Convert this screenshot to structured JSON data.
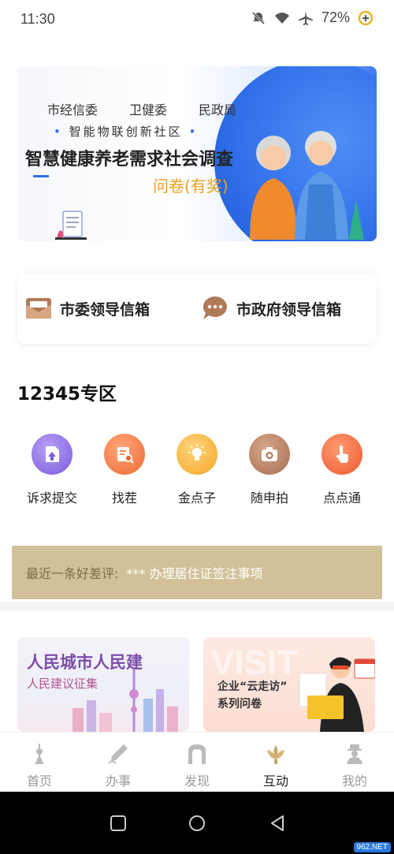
{
  "status_bar": {
    "time": "11:30",
    "battery": "72%"
  },
  "banner": {
    "agencies": [
      "市经信委",
      "卫健委",
      "民政局"
    ],
    "subtitle": "智能物联创新社区",
    "title": "智慧健康养老需求社会调查",
    "tag": "问卷(有奖)"
  },
  "mailbox": {
    "left_label": "市委领导信箱",
    "right_label": "市政府领导信箱"
  },
  "section": {
    "title": "12345专区"
  },
  "services": [
    {
      "label": "诉求提交",
      "icon": "upload-icon",
      "color": "#8f6ee6"
    },
    {
      "label": "找茬",
      "icon": "search-doc-icon",
      "color": "#f07a48"
    },
    {
      "label": "金点子",
      "icon": "lightbulb-icon",
      "color": "#f8b23c"
    },
    {
      "label": "随申拍",
      "icon": "camera-icon",
      "color": "#b47a60"
    },
    {
      "label": "点点通",
      "icon": "tap-icon",
      "color": "#f06a40"
    }
  ],
  "review": {
    "label": "最近一条好差评:",
    "text": "*** 办理居住证签注事项"
  },
  "features": {
    "left": {
      "title": "人民城市人民建",
      "subtitle": "人民建议征集"
    },
    "right": {
      "title": "企业“云走访”",
      "subtitle": "系列问卷",
      "bg_text": "VISIT"
    }
  },
  "tabs": [
    {
      "label": "首页",
      "icon": "home-tower-icon",
      "active": false
    },
    {
      "label": "办事",
      "icon": "pen-icon",
      "active": false
    },
    {
      "label": "发现",
      "icon": "arch-icon",
      "active": false
    },
    {
      "label": "互动",
      "icon": "flower-icon",
      "active": true
    },
    {
      "label": "我的",
      "icon": "person-hat-icon",
      "active": false
    }
  ],
  "watermark": "962.NET"
}
